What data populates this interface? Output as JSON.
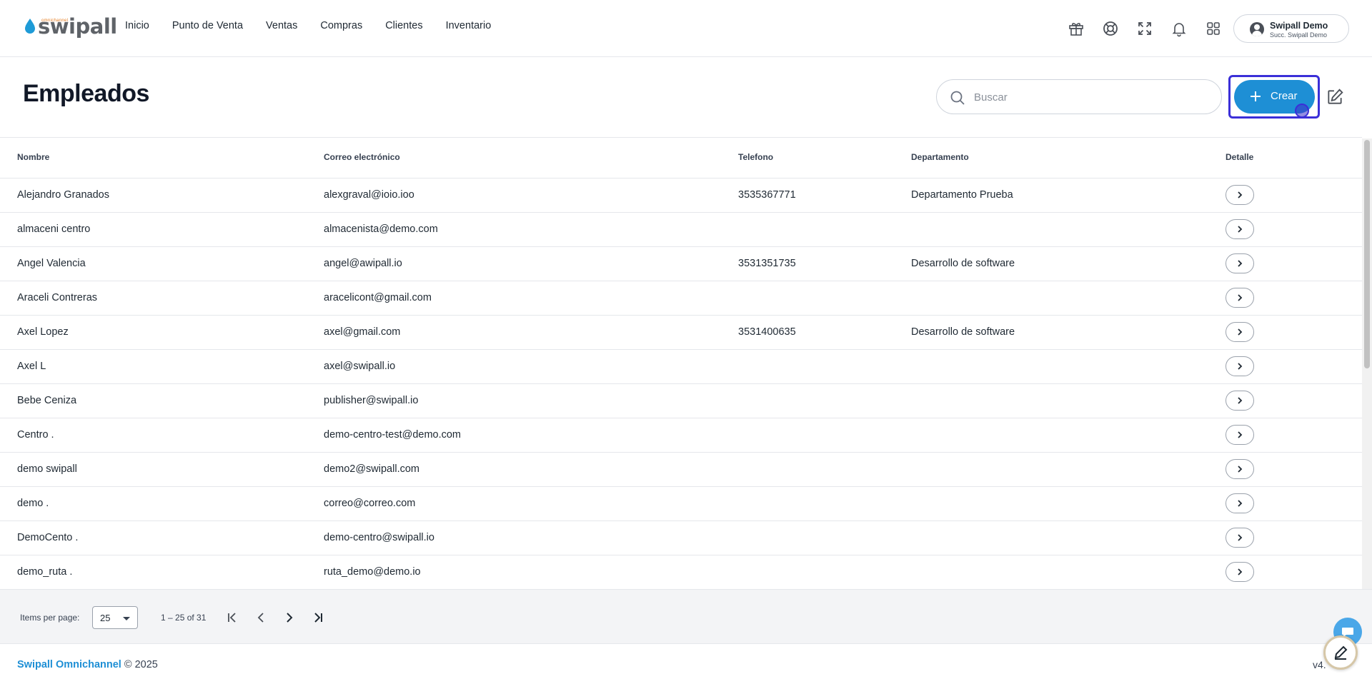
{
  "app": {
    "logo_text": "swipall",
    "logo_sub": "omnichannel"
  },
  "nav": {
    "items": [
      "Inicio",
      "Punto de Venta",
      "Ventas",
      "Compras",
      "Clientes",
      "Inventario"
    ]
  },
  "header_icons": [
    "gift-icon",
    "support-icon",
    "fullscreen-icon",
    "bell-icon",
    "apps-grid-icon"
  ],
  "user": {
    "name": "Swipall Demo",
    "branch": "Succ. Swipall Demo"
  },
  "page": {
    "title": "Empleados",
    "search_placeholder": "Buscar",
    "create_label": "Crear"
  },
  "table": {
    "columns": [
      "Nombre",
      "Correo electrónico",
      "Telefono",
      "Departamento",
      "Detalle"
    ],
    "rows": [
      {
        "name": "Alejandro Granados",
        "email": "alexgraval@ioio.ioo",
        "phone": "3535367771",
        "department": "Departamento Prueba"
      },
      {
        "name": "almaceni centro",
        "email": "almacenista@demo.com",
        "phone": "",
        "department": ""
      },
      {
        "name": "Angel Valencia",
        "email": "angel@awipall.io",
        "phone": "3531351735",
        "department": "Desarrollo de software"
      },
      {
        "name": "Araceli Contreras",
        "email": "aracelicont@gmail.com",
        "phone": "",
        "department": ""
      },
      {
        "name": "Axel Lopez",
        "email": "axel@gmail.com",
        "phone": "3531400635",
        "department": "Desarrollo de software"
      },
      {
        "name": "Axel L",
        "email": "axel@swipall.io",
        "phone": "",
        "department": ""
      },
      {
        "name": "Bebe Ceniza",
        "email": "publisher@swipall.io",
        "phone": "",
        "department": ""
      },
      {
        "name": "Centro .",
        "email": "demo-centro-test@demo.com",
        "phone": "",
        "department": ""
      },
      {
        "name": "demo swipall",
        "email": "demo2@swipall.com",
        "phone": "",
        "department": ""
      },
      {
        "name": "demo .",
        "email": "correo@correo.com",
        "phone": "",
        "department": ""
      },
      {
        "name": "DemoCento .",
        "email": "demo-centro@swipall.io",
        "phone": "",
        "department": ""
      },
      {
        "name": "demo_ruta .",
        "email": "ruta_demo@demo.io",
        "phone": "",
        "department": ""
      }
    ]
  },
  "paginator": {
    "items_per_page_label": "Items per page:",
    "page_size": "25",
    "range_label": "1 – 25 of 31"
  },
  "footer": {
    "brand": "Swipall Omnichannel",
    "copyright": "© 2025",
    "version": "v4."
  },
  "colors": {
    "accent": "#1e8fd5",
    "focus_ring": "#3b2fd8",
    "logo_gray": "#5f6368"
  }
}
